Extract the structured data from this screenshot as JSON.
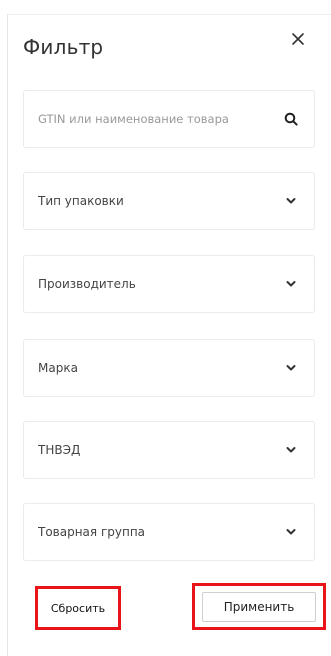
{
  "filter": {
    "title": "Фильтр",
    "search": {
      "placeholder": "GTIN или наименование товара",
      "value": ""
    },
    "dropdowns": [
      {
        "label": "Тип упаковки"
      },
      {
        "label": "Производитель"
      },
      {
        "label": "Марка"
      },
      {
        "label": "ТНВЭД"
      },
      {
        "label": "Товарная группа"
      }
    ],
    "actions": {
      "reset_label": "Сбросить",
      "apply_label": "Применить"
    },
    "icons": {
      "close": "close-icon",
      "search": "search-icon",
      "chevron": "chevron-down-icon"
    },
    "colors": {
      "highlight": "#e8141a"
    }
  }
}
